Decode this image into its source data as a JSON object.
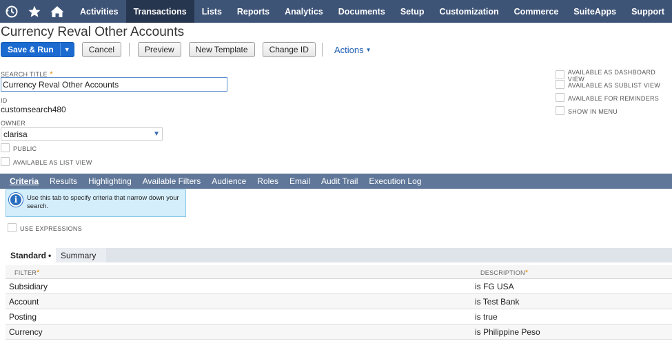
{
  "nav": {
    "icons": [
      "recent-icon",
      "star-icon",
      "home-icon"
    ],
    "items": [
      {
        "label": "Activities"
      },
      {
        "label": "Transactions",
        "active": true
      },
      {
        "label": "Lists"
      },
      {
        "label": "Reports"
      },
      {
        "label": "Analytics"
      },
      {
        "label": "Documents"
      },
      {
        "label": "Setup"
      },
      {
        "label": "Customization"
      },
      {
        "label": "Commerce"
      },
      {
        "label": "SuiteApps"
      },
      {
        "label": "Support"
      }
    ]
  },
  "page": {
    "title": "Currency Reval Other Accounts"
  },
  "toolbar": {
    "save_run": "Save & Run",
    "cancel": "Cancel",
    "preview": "Preview",
    "new_template": "New Template",
    "change_id": "Change ID",
    "actions": "Actions"
  },
  "form": {
    "search_title_label": "SEARCH TITLE",
    "search_title_value": "Currency Reval Other Accounts",
    "id_label": "ID",
    "id_value": "customsearch480",
    "owner_label": "OWNER",
    "owner_value": "clarisa",
    "public_label": "PUBLIC",
    "list_view_label": "AVAILABLE AS LIST VIEW",
    "right_checks": [
      "AVAILABLE AS DASHBOARD VIEW",
      "AVAILABLE AS SUBLIST VIEW",
      "AVAILABLE FOR REMINDERS",
      "SHOW IN MENU"
    ]
  },
  "subtabs": [
    {
      "label": "Criteria",
      "active": true
    },
    {
      "label": "Results"
    },
    {
      "label": "Highlighting"
    },
    {
      "label": "Available Filters"
    },
    {
      "label": "Audience"
    },
    {
      "label": "Roles"
    },
    {
      "label": "Email"
    },
    {
      "label": "Audit Trail"
    },
    {
      "label": "Execution Log"
    }
  ],
  "criteria": {
    "info_text": "Use this tab to specify criteria that narrow down your search.",
    "use_expressions_label": "USE EXPRESSIONS",
    "tab_standard": "Standard",
    "tab_standard_marker": "•",
    "tab_summary": "Summary",
    "col_filter": "FILTER",
    "col_description": "DESCRIPTION",
    "rows": [
      {
        "filter": "Subsidiary",
        "description": "is FG USA"
      },
      {
        "filter": "Account",
        "description": "is Test Bank"
      },
      {
        "filter": "Posting",
        "description": "is true"
      },
      {
        "filter": "Currency",
        "description": "is Philippine Peso"
      }
    ]
  },
  "colors": {
    "nav_bg": "#3e5477",
    "nav_active": "#27364f",
    "subtab_bg": "#607799",
    "primary": "#1b6ad0",
    "required": "#e08a00"
  }
}
